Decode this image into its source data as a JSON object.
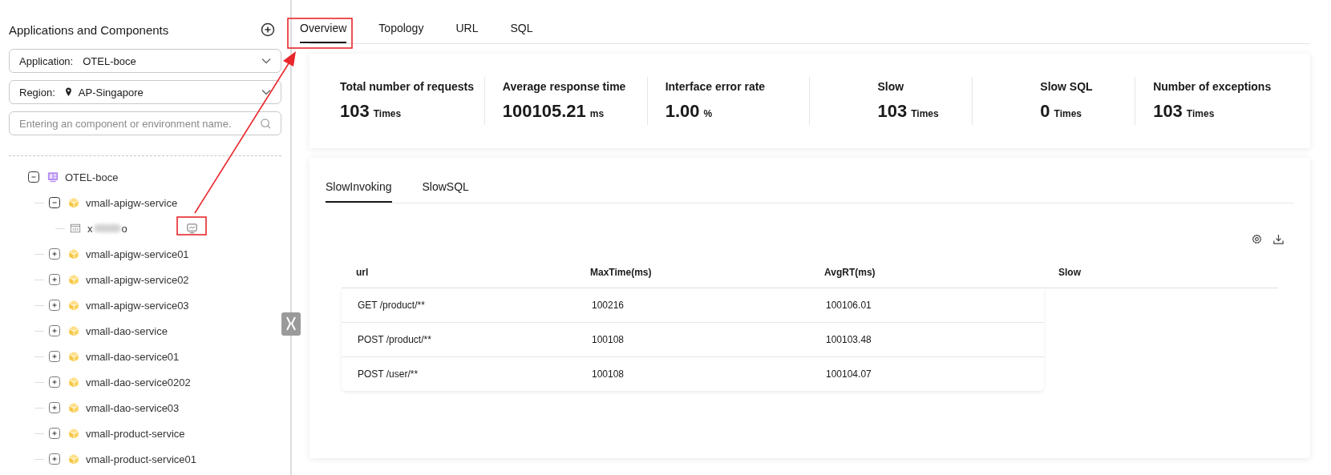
{
  "sidebar": {
    "title": "Applications and Components",
    "application_select": {
      "label": "Application:",
      "value": "OTEL-boce"
    },
    "region_select": {
      "label": "Region:",
      "value": "AP-Singapore"
    },
    "search": {
      "placeholder": "Entering an component or environment name."
    },
    "tree": [
      {
        "kind": "application",
        "label": "OTEL-boce",
        "expanded": true,
        "children": [
          {
            "kind": "component",
            "label": "vmall-apigw-service",
            "expanded": true,
            "children": [
              {
                "kind": "environment",
                "label_start": "x",
                "label_end": "o"
              }
            ]
          },
          {
            "kind": "component",
            "label": "vmall-apigw-service01",
            "expanded": false
          },
          {
            "kind": "component",
            "label": "vmall-apigw-service02",
            "expanded": false
          },
          {
            "kind": "component",
            "label": "vmall-apigw-service03",
            "expanded": false
          },
          {
            "kind": "component",
            "label": "vmall-dao-service",
            "expanded": false
          },
          {
            "kind": "component",
            "label": "vmall-dao-service01",
            "expanded": false
          },
          {
            "kind": "component",
            "label": "vmall-dao-service0202",
            "expanded": false
          },
          {
            "kind": "component",
            "label": "vmall-dao-service03",
            "expanded": false
          },
          {
            "kind": "component",
            "label": "vmall-product-service",
            "expanded": false
          },
          {
            "kind": "component",
            "label": "vmall-product-service01",
            "expanded": false
          }
        ]
      }
    ]
  },
  "tabs": [
    {
      "label": "Overview",
      "selected": true
    },
    {
      "label": "Topology",
      "selected": false
    },
    {
      "label": "URL",
      "selected": false
    },
    {
      "label": "SQL",
      "selected": false
    }
  ],
  "metrics": [
    {
      "label": "Total number of requests",
      "value": "103",
      "unit": "Times"
    },
    {
      "label": "Average response time",
      "value": "100105.21",
      "unit": "ms"
    },
    {
      "label": "Interface error rate",
      "value": "1.00",
      "unit": "%"
    },
    {
      "label": "Slow",
      "value": "103",
      "unit": "Times"
    },
    {
      "label": "Slow SQL",
      "value": "0",
      "unit": "Times"
    },
    {
      "label": "Number of exceptions",
      "value": "103",
      "unit": "Times"
    }
  ],
  "subtabs": [
    {
      "label": "SlowInvoking",
      "selected": true
    },
    {
      "label": "SlowSQL",
      "selected": false
    }
  ],
  "table": {
    "columns": [
      "url",
      "MaxTime(ms)",
      "AvgRT(ms)",
      "Slow"
    ],
    "rows": [
      [
        "GET /product/**",
        "100216",
        "100106.01"
      ],
      [
        "POST /product/**",
        "100108",
        "100103.48"
      ],
      [
        "POST /user/**",
        "100108",
        "100104.07"
      ]
    ]
  }
}
